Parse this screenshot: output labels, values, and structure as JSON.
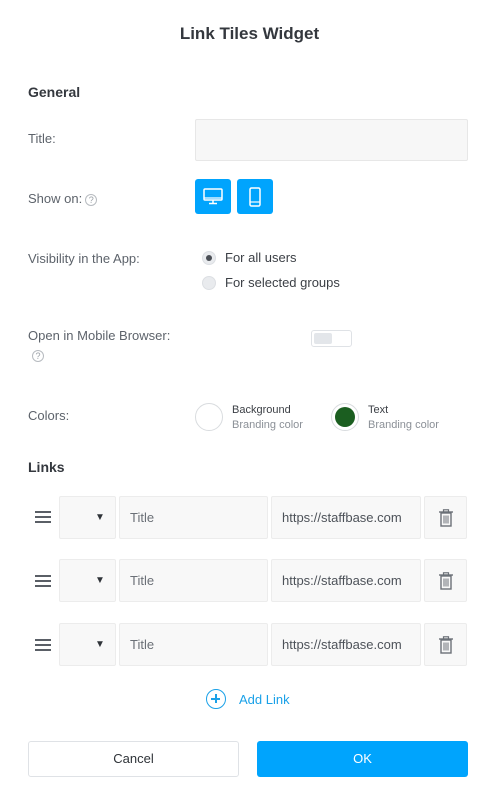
{
  "dialog": {
    "title": "Link Tiles Widget"
  },
  "general": {
    "heading": "General",
    "title_label": "Title:",
    "title_value": "",
    "show_on_label": "Show on:",
    "help_glyph": "?",
    "show_on_devices": [
      "desktop-icon",
      "mobile-icon"
    ],
    "visibility_label": "Visibility in the App:",
    "visibility_options": [
      {
        "label": "For all users",
        "selected": true
      },
      {
        "label": "For selected groups",
        "selected": false
      }
    ],
    "mobile_browser_label": "Open in Mobile Browser:",
    "mobile_browser_enabled": false,
    "colors_label": "Colors:",
    "colors": [
      {
        "name": "Background",
        "sub": "Branding color",
        "hex": "#ffffff"
      },
      {
        "name": "Text",
        "sub": "Branding color",
        "hex": "#1b5e20"
      }
    ]
  },
  "links": {
    "heading": "Links",
    "rows": [
      {
        "icon_select": "▼",
        "title_placeholder": "Title",
        "url": "https://staffbase.com"
      },
      {
        "icon_select": "▼",
        "title_placeholder": "Title",
        "url": "https://staffbase.com"
      },
      {
        "icon_select": "▼",
        "title_placeholder": "Title",
        "url": "https://staffbase.com"
      }
    ],
    "add_label": "Add Link"
  },
  "footer": {
    "cancel_label": "Cancel",
    "ok_label": "OK"
  },
  "colors": {
    "accent": "#00a4fd",
    "link": "#1aa1e8"
  }
}
